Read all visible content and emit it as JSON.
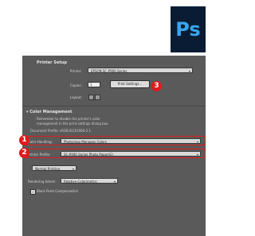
{
  "logo": {
    "text": "Ps",
    "bg": "#0a1c33",
    "fg": "#37a6f0"
  },
  "printer_setup": {
    "heading": "Printer Setup",
    "printer_label": "Printer:",
    "printer_value": "EPSON SC-P900 Series",
    "copies_label": "Copies:",
    "copies_value": "1",
    "print_settings_label": "Print Settings...",
    "layout_label": "Layout:"
  },
  "color_management": {
    "heading": "Color Management",
    "description_line1": "Remember to disable the printer's color",
    "description_line2": "management in the print settings dialog box.",
    "document_profile": "Document Profile: sRGB IEC61966-2.1",
    "color_handling_label": "Color Handling:",
    "color_handling_value": "Photoshop Manages Colors",
    "printer_profile_label": "Printer Profile:",
    "printer_profile_value": "SC-P900 Series Photo Paper(G)",
    "print_mode_value": "Normal Printing",
    "rendering_intent_label": "Rendering Intent:",
    "rendering_intent_value": "Relative Colorimetric",
    "bpc_label": "Black Point Compensation",
    "bpc_checked": "✓"
  },
  "markers": {
    "one": "1",
    "two": "2",
    "three": "3",
    "color": "#e01b1b"
  }
}
